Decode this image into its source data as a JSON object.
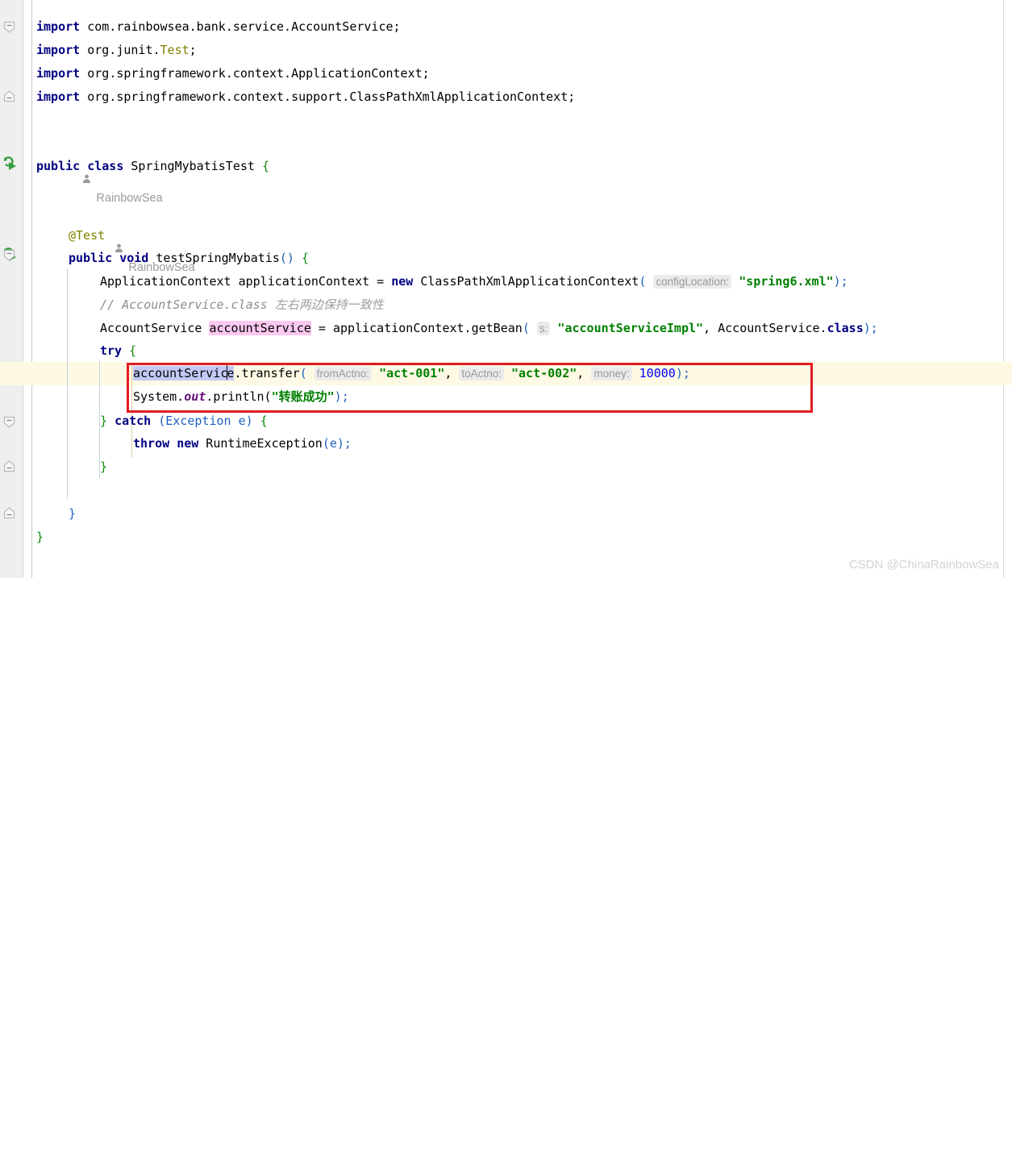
{
  "editor": {
    "watermark": "CSDN @ChinaRainbowSea",
    "colors": {
      "keyword": "#000080",
      "string": "#008000",
      "number": "#0000ff",
      "comment": "#8c8c8c",
      "annotation": "#808000",
      "static_field": "#660e7a",
      "param_hint_text": "#999999",
      "param_hint_bg": "#ebebeb",
      "current_line_bg": "#fdf9e4",
      "gutter_bg": "#efefef",
      "highlight_pink": "#fbc8f0",
      "highlight_blue": "#c3c9f5",
      "annotation_box": "#e31b23",
      "run_icon_green": "#389e3f",
      "watermark": "#d2d2d2"
    }
  },
  "code_vision": [
    {
      "author": "RainbowSea",
      "icon": "person-icon"
    },
    {
      "author": "RainbowSea",
      "icon": "person-icon"
    }
  ],
  "gutter": {
    "run_icons": [
      {
        "name": "run-test-class-icon",
        "tooltip": "Run Test"
      },
      {
        "name": "run-test-method-icon",
        "tooltip": "Run Test"
      }
    ],
    "fold_markers": [
      {
        "name": "fold-marker-imports-open",
        "state": "expanded"
      },
      {
        "name": "fold-marker-imports-end",
        "state": "collapsed"
      },
      {
        "name": "fold-marker-method-open",
        "state": "expanded"
      },
      {
        "name": "fold-marker-catch-open",
        "state": "expanded"
      },
      {
        "name": "fold-marker-catch-end",
        "state": "collapsed"
      },
      {
        "name": "fold-marker-method-end",
        "state": "collapsed"
      }
    ]
  },
  "lines": {
    "l1": {
      "kw_import": "import",
      "path": " com.rainbowsea.bank.service.AccountService;"
    },
    "l2": {
      "kw_import": "import",
      "path_a": " org.junit.",
      "type": "Test",
      "path_b": ";"
    },
    "l3": {
      "kw_import": "import",
      "path": " org.springframework.context.ApplicationContext;"
    },
    "l4": {
      "kw_import": "import",
      "path": " org.springframework.context.support.ClassPathXmlApplicationContext;"
    },
    "class_decl": {
      "kw_public": "public",
      "kw_class": "class",
      "name": "SpringMybatisTest",
      "brace": "{"
    },
    "annotation_test": "@Test",
    "method_decl": {
      "kw_public": "public",
      "kw_void": "void",
      "name": "testSpringMybatis",
      "parens": "()",
      "brace": "{"
    },
    "ctx_line": {
      "type": "ApplicationContext",
      "var": " applicationContext = ",
      "kw_new": "new",
      "ctor": " ClassPathXmlApplicationContext",
      "open_paren": "(",
      "hint": "configLocation:",
      "arg": "\"spring6.xml\"",
      "close": ");"
    },
    "comment_line": {
      "ascii": "// AccountService.class ",
      "cjk": "左右两边保持一致性"
    },
    "getbean_line": {
      "type": "AccountService ",
      "var": "accountService",
      "mid": " = applicationContext.getBean",
      "open_paren": "(",
      "hint": "s:",
      "arg1": "\"accountServiceImpl\"",
      "comma": ", AccountService.",
      "kw_class": "class",
      "close": ");"
    },
    "try_line": {
      "kw": "try",
      "brace": "{"
    },
    "transfer_line": {
      "var": "accountService",
      "call": ".transfer",
      "open_paren": "(",
      "hint1": "fromActno:",
      "arg1": "\"act-001\"",
      "sep1": ", ",
      "hint2": "toActno:",
      "arg2": "\"act-002\"",
      "sep2": ", ",
      "hint3": "money:",
      "arg3": "10000",
      "close": ");"
    },
    "println_line": {
      "prefix": "System.",
      "field": "out",
      "call": ".println(",
      "quote_open": "\"",
      "cjk": "转账成功",
      "quote_close": "\"",
      "close": ");"
    },
    "catch_line": {
      "close_brace": "}",
      "kw": "catch",
      "params": " (Exception e) ",
      "brace": "{"
    },
    "throw_line": {
      "kw_throw": "throw",
      "kw_new": "new",
      "ctor": " RuntimeException",
      "args": "(e);"
    },
    "close_catch": "}",
    "close_method": "}",
    "close_class": "}"
  }
}
